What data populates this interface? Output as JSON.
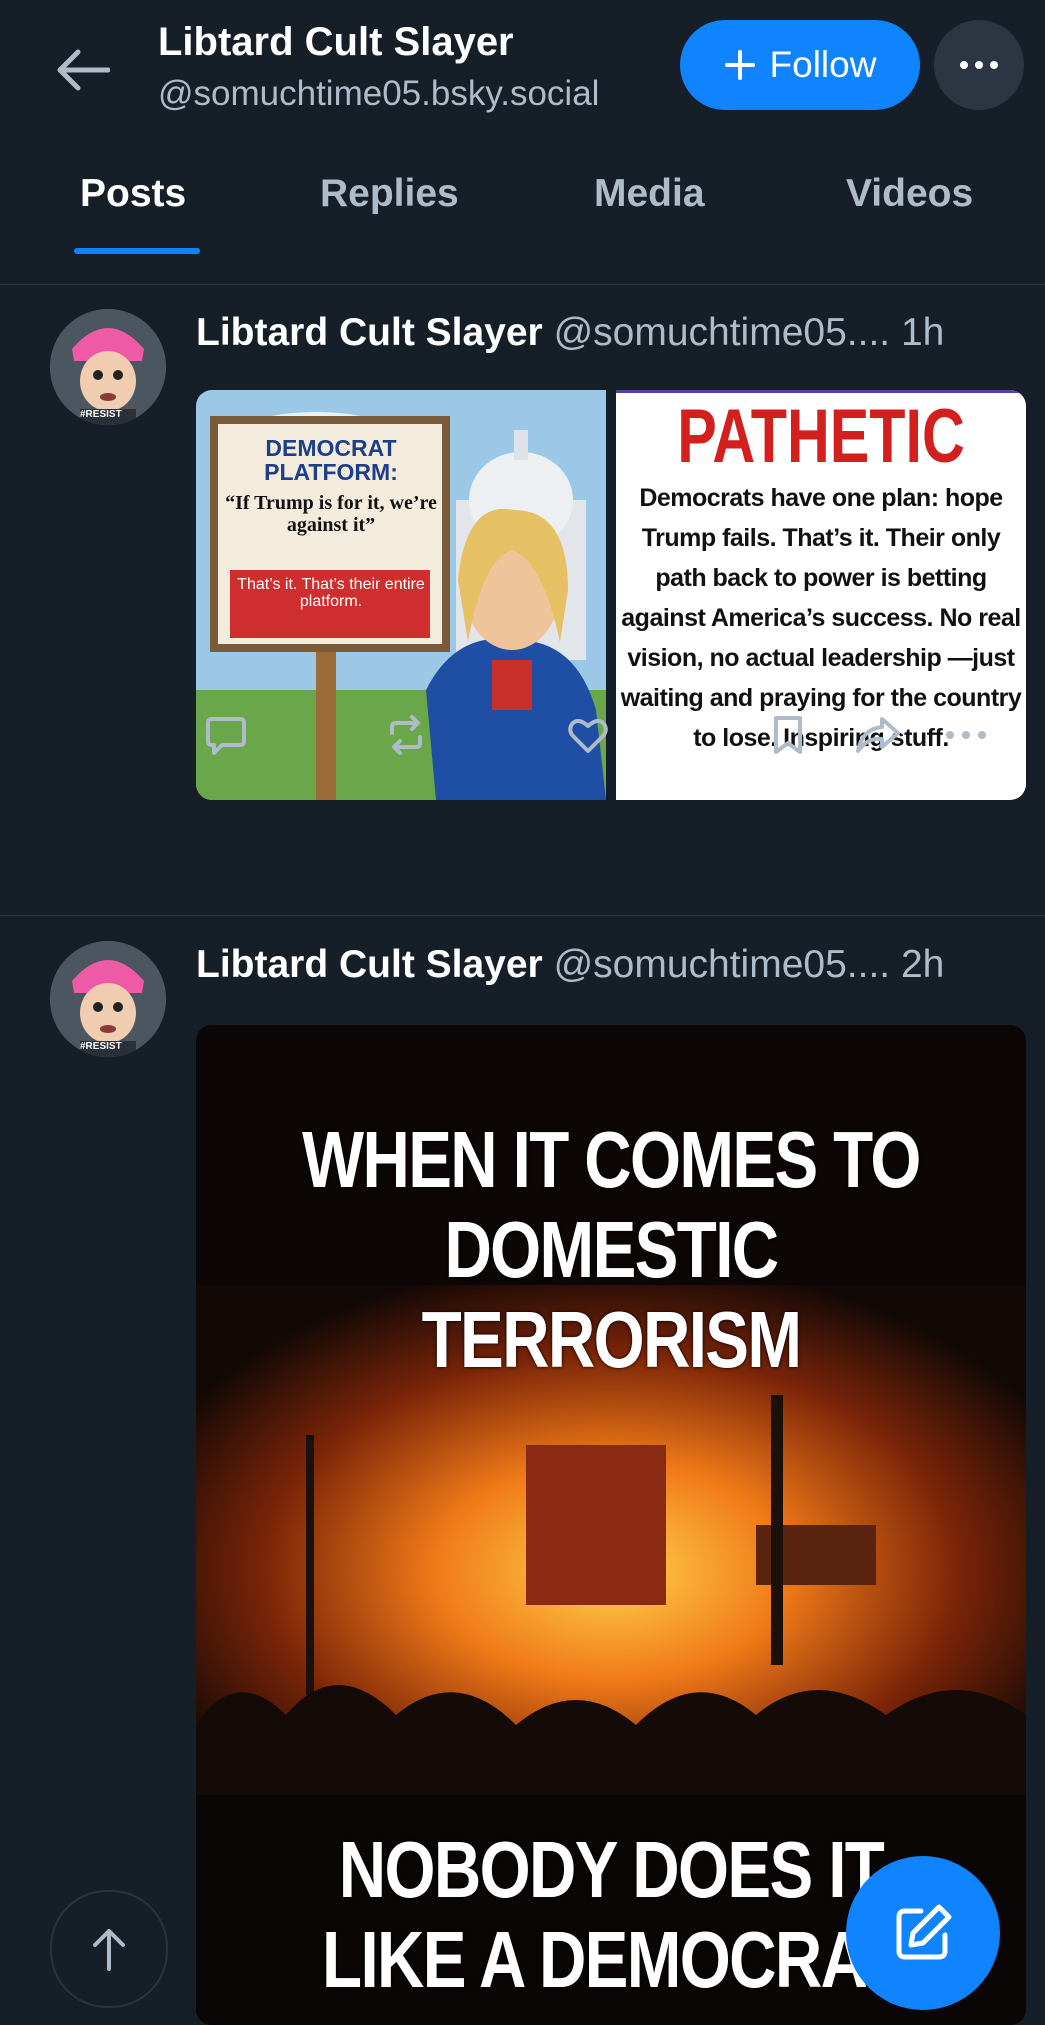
{
  "header": {
    "display_name": "Libtard Cult Slayer",
    "handle": "@somuchtime05.bsky.social",
    "follow_label": "Follow"
  },
  "tabs": [
    {
      "label": "Posts",
      "active": true
    },
    {
      "label": "Replies",
      "active": false
    },
    {
      "label": "Media",
      "active": false
    },
    {
      "label": "Videos",
      "active": false
    }
  ],
  "posts": [
    {
      "author": "Libtard Cult Slayer",
      "handle": "@somuchtime05....",
      "time": "1h",
      "avatar_badge": "#RESIST",
      "images": [
        {
          "sign_title": "DEMOCRAT PLATFORM:",
          "sign_quote": "“If Trump is for it, we’re against it”",
          "sign_footer": "That’s it. That’s their entire platform."
        },
        {
          "headline": "PATHETIC",
          "body": "Democrats have one plan: hope Trump fails. That’s it. Their only path back to power is betting against America’s success. No real vision, no actual leadership —just waiting and praying for the country to lose. Inspiring stuff."
        }
      ]
    },
    {
      "author": "Libtard Cult Slayer",
      "handle": "@somuchtime05....",
      "time": "2h",
      "avatar_badge": "#RESIST",
      "image": {
        "top_text": "WHEN IT COMES TO DOMESTIC TERRORISM",
        "bottom_text": "NOBODY DOES IT LIKE A DEMOCRAT"
      }
    }
  ],
  "icons": {
    "back": "arrow-left-icon",
    "plus": "plus-icon",
    "more": "ellipsis-icon",
    "reply": "chat-bubble-icon",
    "repost": "repost-icon",
    "like": "heart-icon",
    "bookmark": "bookmark-icon",
    "share": "share-arrow-icon",
    "compose": "pencil-square-icon",
    "scroll_top": "arrow-up-icon"
  },
  "colors": {
    "background": "#161e27",
    "accent": "#1083fe",
    "muted_text": "#aebbc9"
  }
}
